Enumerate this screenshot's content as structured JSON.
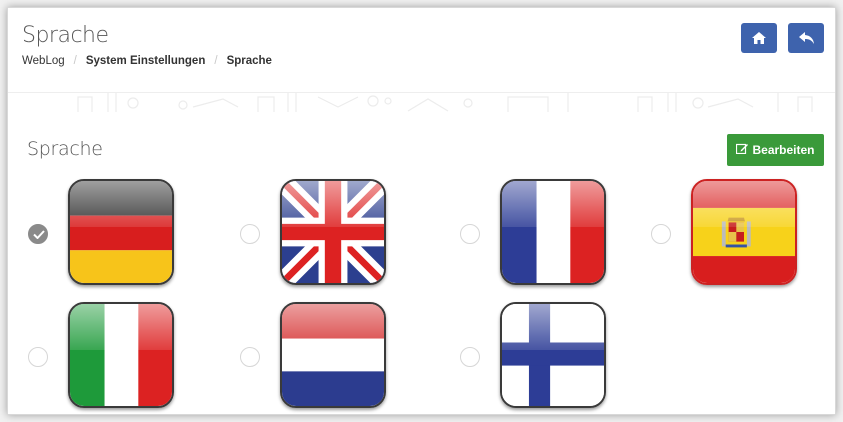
{
  "header": {
    "title": "Sprache",
    "breadcrumb": [
      "WebLog",
      "System Einstellungen",
      "Sprache"
    ],
    "home_icon": "home-icon",
    "back_icon": "reply-icon"
  },
  "section": {
    "title": "Sprache",
    "edit_label": "Bearbeiten",
    "edit_icon": "edit-icon"
  },
  "languages": [
    {
      "flag": "germany-flag",
      "selected": true
    },
    {
      "flag": "united-kingdom-flag",
      "selected": false
    },
    {
      "flag": "france-flag",
      "selected": false
    },
    {
      "flag": "spain-flag",
      "selected": false
    },
    {
      "flag": "italy-flag",
      "selected": false
    },
    {
      "flag": "netherlands-flag",
      "selected": false
    },
    {
      "flag": "finland-flag",
      "selected": false
    }
  ],
  "colors": {
    "primary": "#3e63ad",
    "success": "#3a9a3a",
    "radio_checked": "#8a8a8a"
  }
}
